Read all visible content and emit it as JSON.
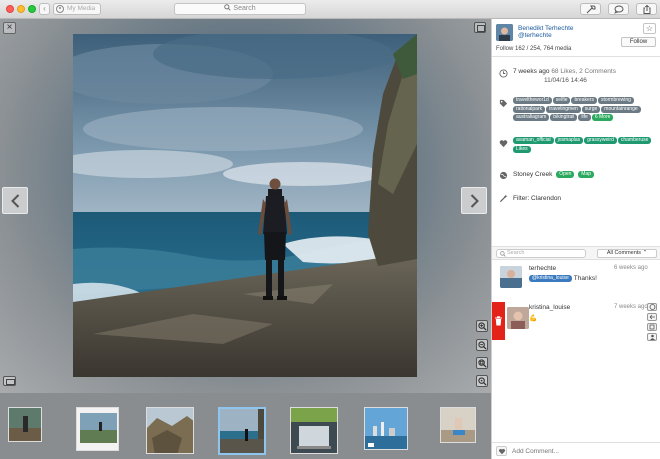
{
  "titlebar": {
    "back_icon": "chevron-left-icon",
    "media_label": "My Media",
    "search_placeholder": "Search",
    "buttons": [
      "tools-icon",
      "speech-bubble-icon",
      "share-icon"
    ]
  },
  "viewer": {
    "close_icon": "close-icon",
    "prev_icon": "chevron-left-icon",
    "next_icon": "chevron-right-icon",
    "zoom_icons": [
      "zoom-in-icon",
      "zoom-out-icon",
      "zoom-fit-icon",
      "zoom-actual-icon"
    ]
  },
  "thumbnails": [
    {
      "name": "thumb-1",
      "selected": false
    },
    {
      "name": "thumb-2",
      "selected": false
    },
    {
      "name": "thumb-3",
      "selected": false
    },
    {
      "name": "thumb-4",
      "selected": true
    },
    {
      "name": "thumb-5",
      "selected": false
    },
    {
      "name": "thumb-6",
      "selected": false
    },
    {
      "name": "thumb-7",
      "selected": false
    }
  ],
  "profile": {
    "name": "Benedikt Terhechte",
    "handle": "@terhechte",
    "stats": "Follow 162 / 254, 764 media",
    "follow_label": "Follow",
    "star_label": "☆"
  },
  "meta": {
    "time_ago": "7 weeks ago",
    "likes_comments": "68 Likes, 2 Comments",
    "date": "11/04/16 14:46",
    "tags": [
      "travelthewor1d",
      "selfie",
      "breakers",
      "stormbrewing",
      "rationalpark",
      "travelingmen",
      "surge",
      "mountainrange",
      "australiagram",
      "bikingtrail",
      "life",
      "6 More"
    ],
    "likes": [
      "avaman_official",
      "josmaplas",
      "grassyweird",
      "chamberuse",
      "Likes"
    ],
    "location": "Stoney Creek",
    "open_label": "Open",
    "map_label": "Map",
    "filter": "Filter: Clarendon"
  },
  "comments": {
    "search_placeholder": "Search",
    "filter_label": "All Comments",
    "items": [
      {
        "user": "terhechte",
        "time": "6 weeks ago",
        "mention": "@kristina_louise",
        "text": "Thanks!"
      },
      {
        "user": "kristina_louise",
        "time": "7 weeks ago",
        "mention": "",
        "text": "💪"
      }
    ],
    "compose_placeholder": "Add Comment..."
  },
  "colors": {
    "link": "#1b5a9c",
    "tag": "#6b7a84",
    "green": "#2aa95f",
    "delete": "#e3231a",
    "selected_thumb": "#8fc6ef"
  }
}
